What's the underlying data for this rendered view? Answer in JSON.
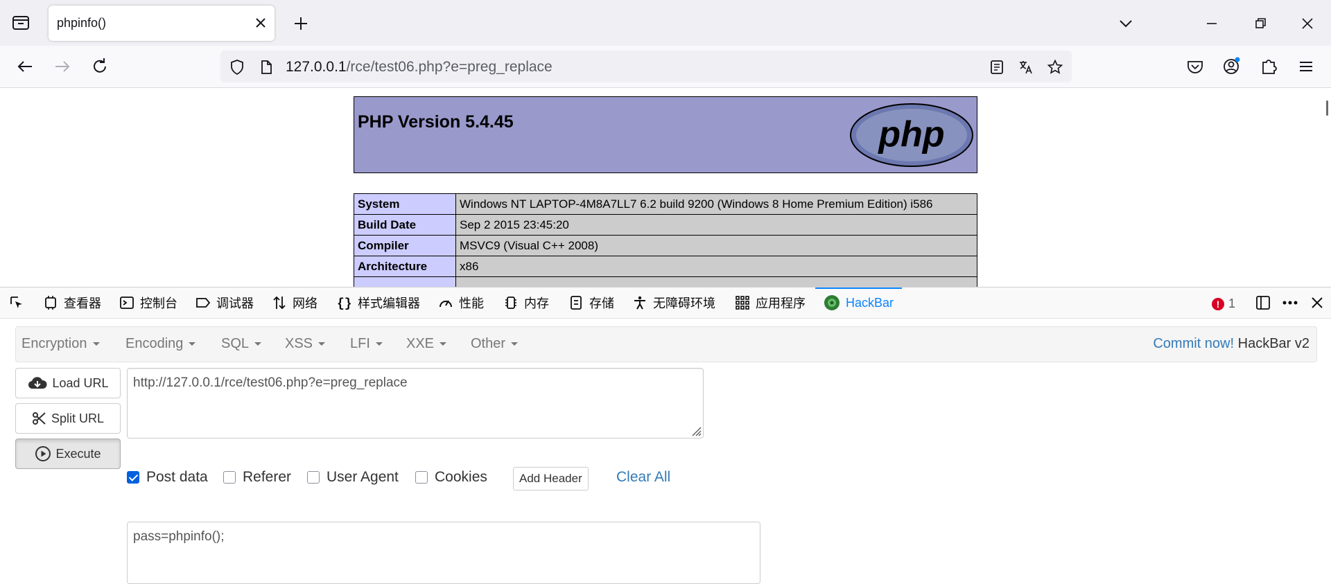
{
  "browser": {
    "tab_title": "phpinfo()",
    "url_host": "127.0.0.1",
    "url_path": "/rce/test06.php?e=preg_replace"
  },
  "phpinfo": {
    "version_title": "PHP Version 5.4.45",
    "logo_text": "php",
    "rows": [
      {
        "key": "System",
        "value": "Windows NT LAPTOP-4M8A7LL7 6.2 build 9200 (Windows 8 Home Premium Edition) i586"
      },
      {
        "key": "Build Date",
        "value": "Sep 2 2015 23:45:20"
      },
      {
        "key": "Compiler",
        "value": "MSVC9 (Visual C++ 2008)"
      },
      {
        "key": "Architecture",
        "value": "x86"
      }
    ]
  },
  "devtools": {
    "tabs": [
      "查看器",
      "控制台",
      "调试器",
      "网络",
      "样式编辑器",
      "性能",
      "内存",
      "存储",
      "无障碍环境",
      "应用程序",
      "HackBar"
    ],
    "error_count": "1"
  },
  "hackbar": {
    "menu": [
      "Encryption",
      "Encoding",
      "SQL",
      "XSS",
      "LFI",
      "XXE",
      "Other"
    ],
    "commit_link": "Commit now!",
    "version": "HackBar v2",
    "load_url": "Load URL",
    "split_url": "Split URL",
    "execute": "Execute",
    "url_value": "http://127.0.0.1/rce/test06.php?e=preg_replace",
    "options": {
      "post_data": "Post data",
      "referer": "Referer",
      "user_agent": "User Agent",
      "cookies": "Cookies",
      "post_data_checked": true
    },
    "add_header": "Add Header",
    "clear_all": "Clear All",
    "post_value": "pass=phpinfo();"
  },
  "colors": {
    "php_header_bg": "#9999cc",
    "php_key_bg": "#ccccff",
    "php_value_bg": "#cccccc",
    "devtools_accent": "#0a84ff",
    "hackbar_link": "#337ab7"
  }
}
